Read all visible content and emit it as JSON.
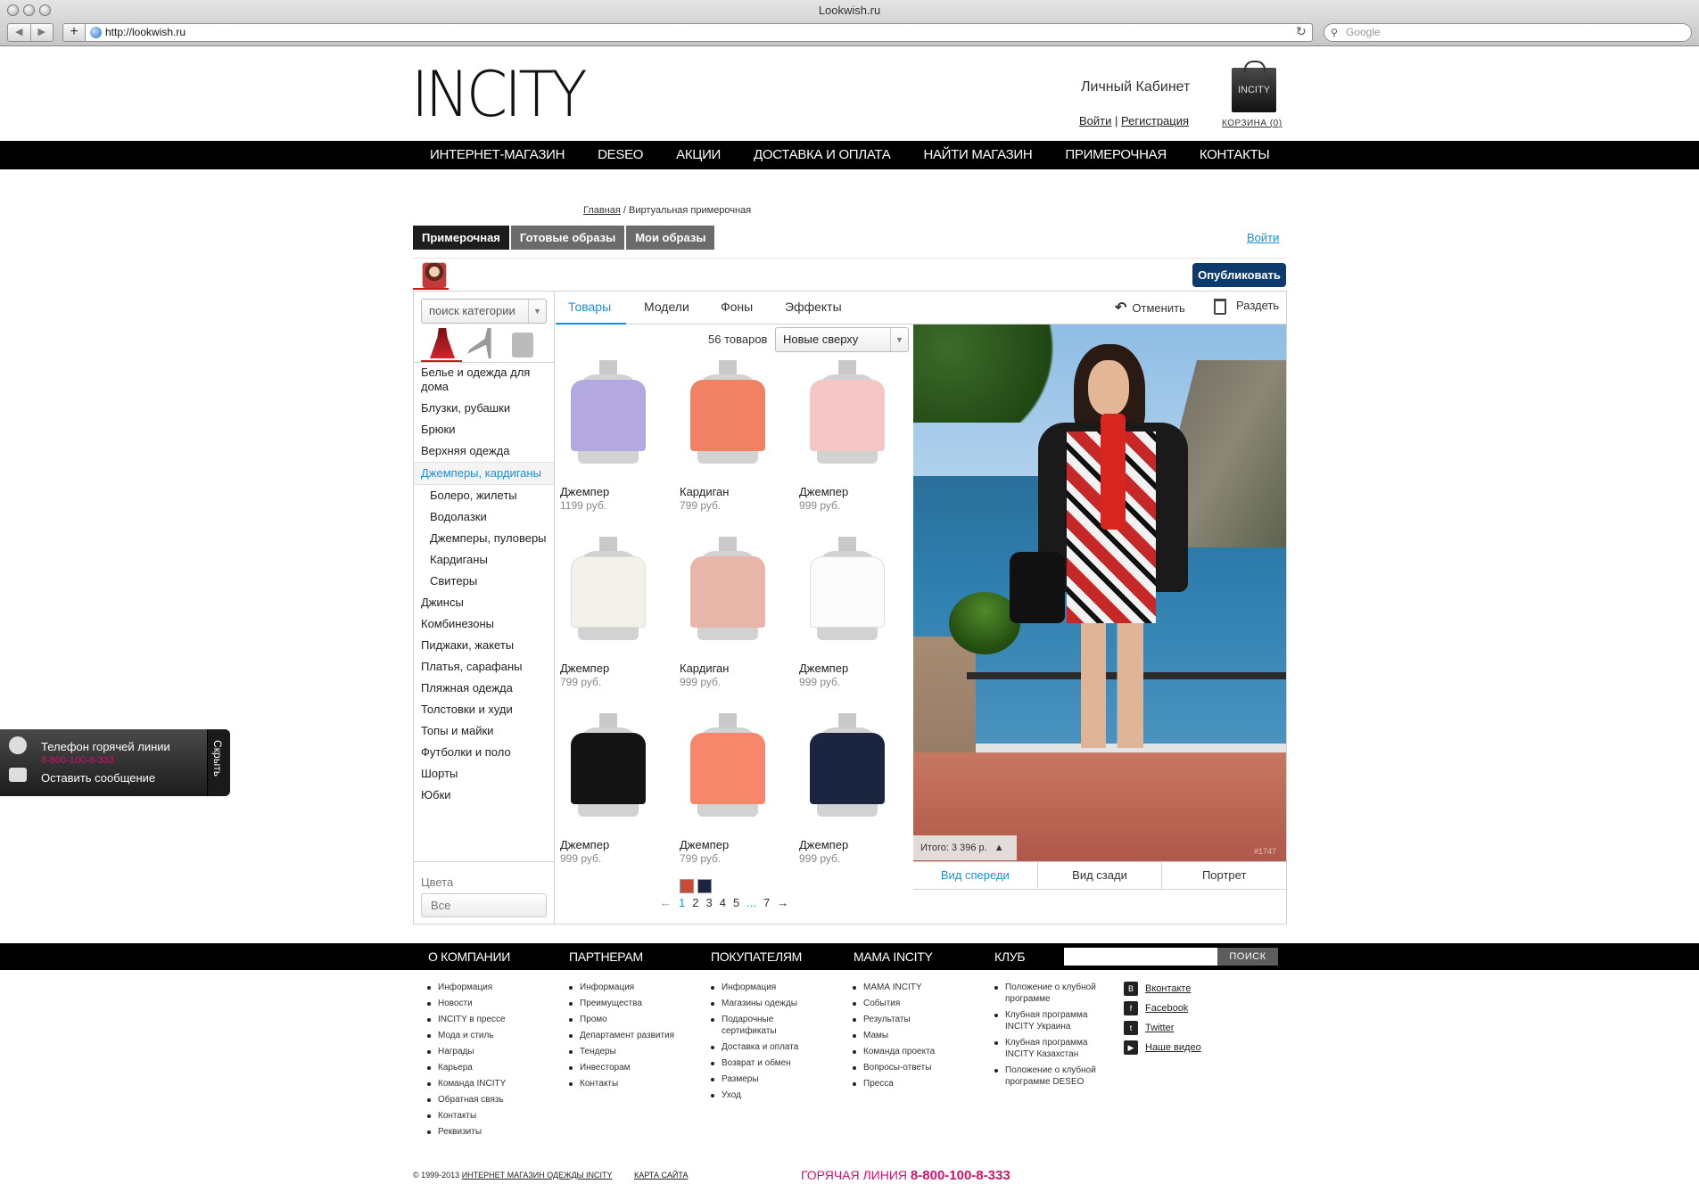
{
  "browser": {
    "window_title": "Lookwish.ru",
    "url": "http://lookwish.ru",
    "search_placeholder": "Google",
    "new_tab": "+",
    "back": "◀",
    "forward": "▶"
  },
  "header": {
    "logo": "INCITY",
    "cabinet": "Личный Кабинет",
    "login": "Войти",
    "separator": "|",
    "register": "Регистрация",
    "bag_text": "INCITY",
    "cart": "КОРЗИНА (0)"
  },
  "topnav": [
    "ИНТЕРНЕТ-МАГАЗИН",
    "DESEO",
    "АКЦИИ",
    "ДОСТАВКА И ОПЛАТА",
    "НАЙТИ МАГАЗИН",
    "ПРИМЕРОЧНАЯ",
    "КОНТАКТЫ"
  ],
  "breadcrumb": {
    "home": "Главная",
    "current": " / Виртуальная примерочная"
  },
  "tabs": [
    {
      "label": "Примерочная",
      "active": true
    },
    {
      "label": "Готовые образы",
      "active": false
    },
    {
      "label": "Мои образы",
      "active": false
    }
  ],
  "login_link": "Войти",
  "publish": "Опубликовать",
  "sidebar": {
    "search_placeholder": "поиск категории",
    "categories": [
      {
        "label": "Белье и одежда для дома",
        "type": "two"
      },
      {
        "label": "Блузки, рубашки"
      },
      {
        "label": "Брюки"
      },
      {
        "label": "Верхняя одежда"
      },
      {
        "label": "Джемперы, кардиганы",
        "type": "active"
      },
      {
        "label": "Болеро, жилеты",
        "type": "sub"
      },
      {
        "label": "Водолазки",
        "type": "sub"
      },
      {
        "label": "Джемперы, пуловеры",
        "type": "sub"
      },
      {
        "label": "Кардиганы",
        "type": "sub"
      },
      {
        "label": "Свитеры",
        "type": "sub"
      },
      {
        "label": "Джинсы"
      },
      {
        "label": "Комбинезоны"
      },
      {
        "label": "Пиджаки, жакеты"
      },
      {
        "label": "Платья, сарафаны"
      },
      {
        "label": "Пляжная одежда"
      },
      {
        "label": "Толстовки и худи"
      },
      {
        "label": "Топы и майки"
      },
      {
        "label": "Футболки и поло"
      },
      {
        "label": "Шорты"
      },
      {
        "label": "Юбки"
      }
    ],
    "colors_label": "Цвета",
    "colors_value": "Все"
  },
  "subtabs": {
    "products": "Товары",
    "models": "Модели",
    "backgrounds": "Фоны",
    "effects": "Эффекты",
    "undo": "Отменить",
    "undress": "Раздеть"
  },
  "listing": {
    "count": "56 товаров",
    "sort": "Новые сверху",
    "products": [
      {
        "name": "Джемпер",
        "price": "1199 руб.",
        "color": "#b3a9e0"
      },
      {
        "name": "Кардиган",
        "price": "799 руб.",
        "color": "#f08163"
      },
      {
        "name": "Джемпер",
        "price": "999 руб.",
        "color": "#f4c6c6"
      },
      {
        "name": "Джемпер",
        "price": "799 руб.",
        "color": "#f4f1ea"
      },
      {
        "name": "Кардиган",
        "price": "999 руб.",
        "color": "#e7b6a9"
      },
      {
        "name": "Джемпер",
        "price": "999 руб.",
        "color": "#fbfbfb"
      },
      {
        "name": "Джемпер",
        "price": "999 руб.",
        "color": "#141414"
      },
      {
        "name": "Джемпер",
        "price": "799 руб.",
        "color": "#f7876b"
      },
      {
        "name": "Джемпер",
        "price": "999 руб.",
        "color": "#1c2540"
      }
    ],
    "swatches": [
      "#c84a37",
      "#1c2540"
    ],
    "pager": {
      "prev": "←",
      "pages": [
        "1",
        "2",
        "3",
        "4",
        "5"
      ],
      "ellipsis": "...",
      "last": "7",
      "next": "→"
    }
  },
  "preview": {
    "total": "Итого: 3 396 р.",
    "total_arrow": "▲",
    "id": "#1747",
    "views": [
      "Вид спереди",
      "Вид сзади",
      "Портрет"
    ]
  },
  "hotline": {
    "title": "Телефон горячей линии",
    "phone": "8-800-100-8-333",
    "message": "Оставить сообщение",
    "hide": "Скрыть"
  },
  "footer": {
    "nav": [
      "О КОМПАНИИ",
      "ПАРТНЕРАМ",
      "ПОКУПАТЕЛЯМ",
      "МАМА INCITY",
      "КЛУБ"
    ],
    "search_button": "ПОИСК",
    "columns": [
      [
        "Информация",
        "Новости",
        "INCITY в прессе",
        "Мода и стиль",
        "Награды",
        "Карьера",
        "Команда INCITY",
        "Обратная связь",
        "Контакты",
        "Реквизиты"
      ],
      [
        "Информация",
        "Преимущества",
        "Промо",
        "Департамент развития",
        "Тендеры",
        "Инвесторам",
        "Контакты"
      ],
      [
        "Информация",
        "Магазины одежды",
        "Подарочные сертификаты",
        "Доставка и оплата",
        "Возврат и обмен",
        "Размеры",
        "Уход"
      ],
      [
        "МАМА INCITY",
        "События",
        "Результаты",
        "Мамы",
        "Команда проекта",
        "Вопросы-ответы",
        "Пресса"
      ],
      [
        "Положение о клубной программе",
        "Клубная программа INCITY Украина",
        "Клубная программа INCITY Казахстан",
        "Положение о клубной программе DESEO"
      ]
    ],
    "social": [
      {
        "label": "Вконтакте",
        "icon": "vk-icon",
        "glyph": "В"
      },
      {
        "label": "Facebook",
        "icon": "facebook-icon",
        "glyph": "f"
      },
      {
        "label": "Twitter",
        "icon": "twitter-icon",
        "glyph": "t"
      },
      {
        "label": "Наше видео",
        "icon": "youtube-icon",
        "glyph": "▶"
      }
    ],
    "copyright": "© 1999-2013 ",
    "copyright_link": "ИНТЕРНЕТ МАГАЗИН ОДЕЖДЫ INCITY",
    "sitemap": "КАРТА САЙТА",
    "hotline_label": "ГОРЯЧАЯ ЛИНИЯ ",
    "hotline_number": "8-800-100-8-333"
  },
  "colors": {
    "accent": "#1a8fd9",
    "publish": "#0d3b6e",
    "hotline": "#d0136f",
    "active_marker": "#c21c1c"
  }
}
